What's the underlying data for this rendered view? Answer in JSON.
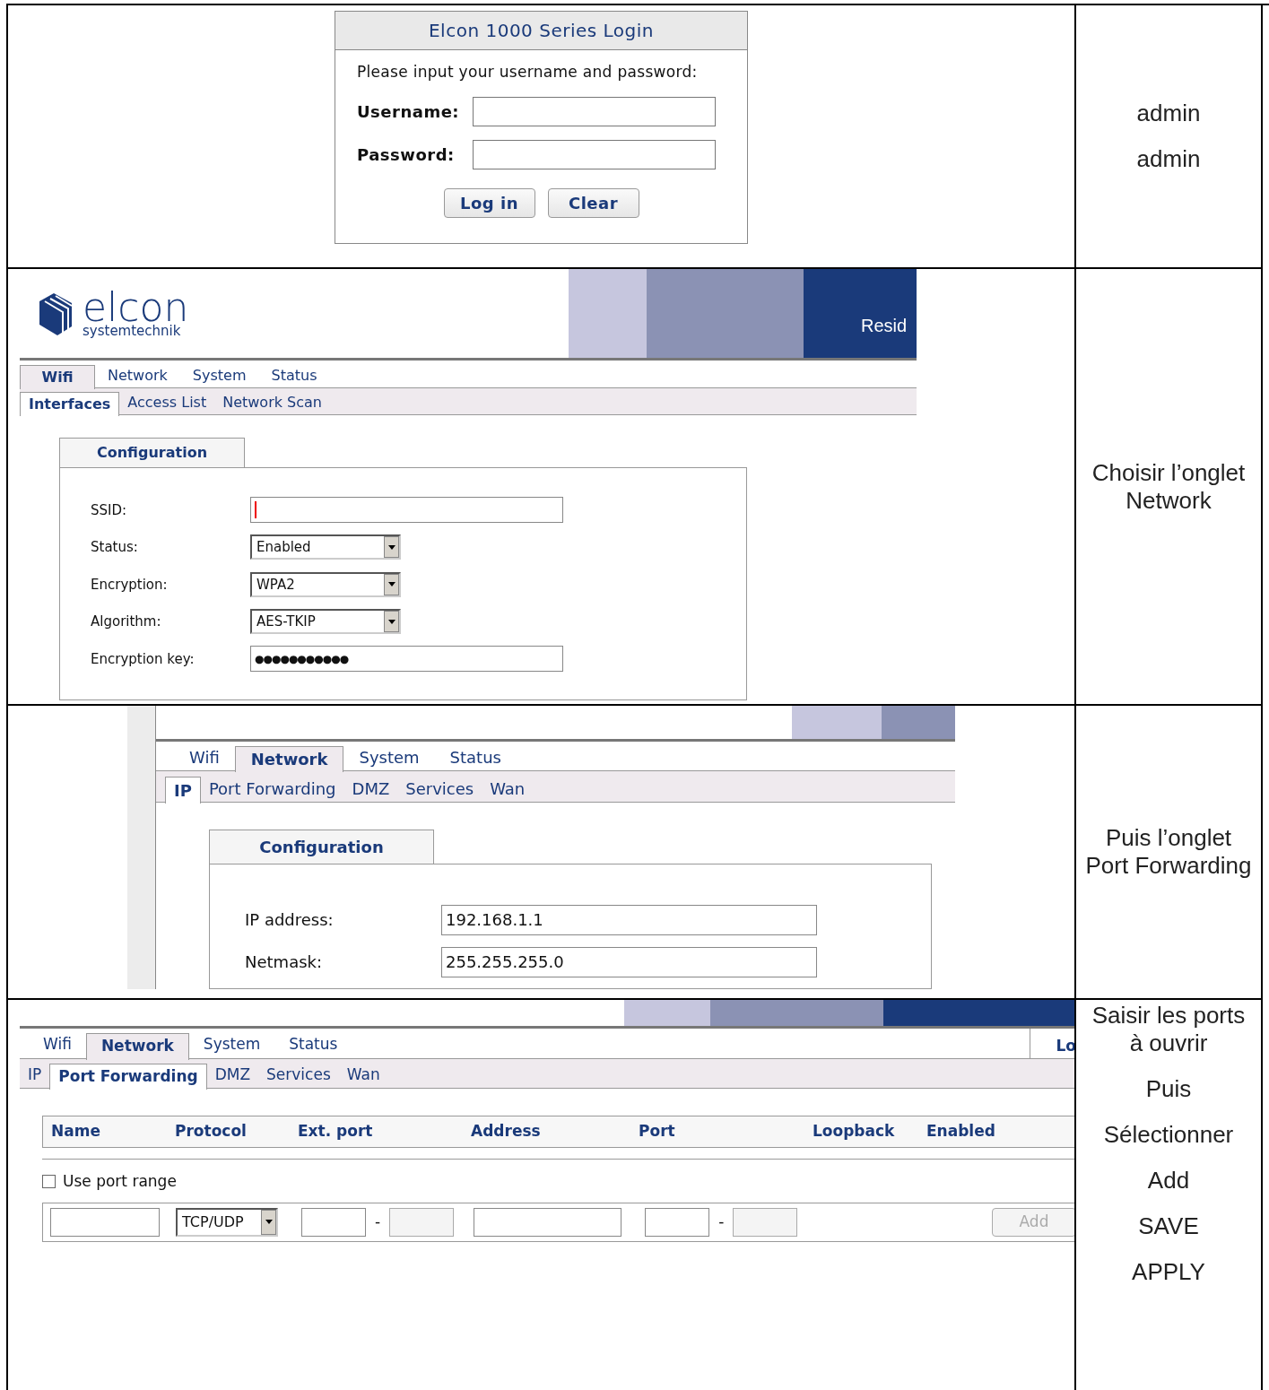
{
  "steps": [
    {
      "kind": "login",
      "screen": {
        "title": "Elcon 1000 Series Login",
        "prompt": "Please input your username and password:",
        "fields": [
          {
            "label": "Username:"
          },
          {
            "label": "Password:"
          }
        ],
        "buttons": [
          {
            "label": "Log in"
          },
          {
            "label": "Clear"
          }
        ]
      },
      "instructions": [
        "admin",
        "admin"
      ]
    },
    {
      "kind": "config",
      "screen": {
        "logo": {
          "name": "elcon",
          "tagline": "systemtechnik"
        },
        "banner_text": "Resid",
        "tabs": [
          {
            "label": "Wifi",
            "selected": true
          },
          {
            "label": "Network",
            "selected": false
          },
          {
            "label": "System",
            "selected": false
          },
          {
            "label": "Status",
            "selected": false
          }
        ],
        "subtabs": [
          {
            "label": "Interfaces",
            "selected": true
          },
          {
            "label": "Access List",
            "selected": false
          },
          {
            "label": "Network Scan",
            "selected": false
          }
        ],
        "panel_title": "Configuration",
        "fields": [
          {
            "kind": "text",
            "label": "SSID:",
            "focused": true
          },
          {
            "kind": "select",
            "label": "Status:",
            "value": "Enabled"
          },
          {
            "kind": "select",
            "label": "Encryption:",
            "value": "WPA2"
          },
          {
            "kind": "select",
            "label": "Algorithm:",
            "value": "AES-TKIP"
          },
          {
            "kind": "password",
            "label": "Encryption key:",
            "value": "●●●●●●●●●●●"
          }
        ]
      },
      "instructions": [
        "Choisir l’onglet Network"
      ]
    },
    {
      "kind": "config",
      "screen": {
        "side_strip": true,
        "tabs": [
          {
            "label": "Wifi",
            "selected": false
          },
          {
            "label": "Network",
            "selected": true
          },
          {
            "label": "System",
            "selected": false
          },
          {
            "label": "Status",
            "selected": false
          }
        ],
        "subtabs": [
          {
            "label": "IP",
            "selected": true
          },
          {
            "label": "Port Forwarding",
            "selected": false
          },
          {
            "label": "DMZ",
            "selected": false
          },
          {
            "label": "Services",
            "selected": false
          },
          {
            "label": "Wan",
            "selected": false
          }
        ],
        "panel_title": "Configuration",
        "fields": [
          {
            "kind": "text",
            "label": "IP address:",
            "value": "192.168.1.1"
          },
          {
            "kind": "text",
            "label": "Netmask:",
            "value": "255.255.255.0"
          }
        ]
      },
      "instructions": [
        "Puis l’onglet Port Forwarding"
      ]
    },
    {
      "kind": "table",
      "screen": {
        "tabs": [
          {
            "label": "Wifi",
            "selected": false
          },
          {
            "label": "Network",
            "selected": true
          },
          {
            "label": "System",
            "selected": false
          },
          {
            "label": "Status",
            "selected": false
          }
        ],
        "logout": "Lo",
        "subtabs": [
          {
            "label": "IP",
            "selected": false
          },
          {
            "label": "Port Forwarding",
            "selected": true
          },
          {
            "label": "DMZ",
            "selected": false
          },
          {
            "label": "Services",
            "selected": false
          },
          {
            "label": "Wan",
            "selected": false
          }
        ],
        "columns": [
          "Name",
          "Protocol",
          "Ext. port",
          "Address",
          "Port",
          "Loopback",
          "Enabled"
        ],
        "range_option": {
          "label": "Use port range",
          "checked": false
        },
        "entry": [
          {
            "kind": "field",
            "disabled": false
          },
          {
            "kind": "select",
            "value": "TCP/UDP"
          },
          {
            "kind": "field",
            "disabled": false
          },
          {
            "kind": "dash",
            "text": "-"
          },
          {
            "kind": "field",
            "disabled": true
          },
          {
            "kind": "field",
            "disabled": false,
            "wide": true
          },
          {
            "kind": "field",
            "disabled": false
          },
          {
            "kind": "dash",
            "text": "-"
          },
          {
            "kind": "field",
            "disabled": true
          },
          {
            "kind": "button",
            "label": "Add",
            "disabled": true
          }
        ]
      },
      "instructions": [
        "Saisir les ports à ouvrir",
        "Puis",
        "Sélectionner",
        "Add",
        "SAVE",
        "APPLY"
      ]
    }
  ]
}
